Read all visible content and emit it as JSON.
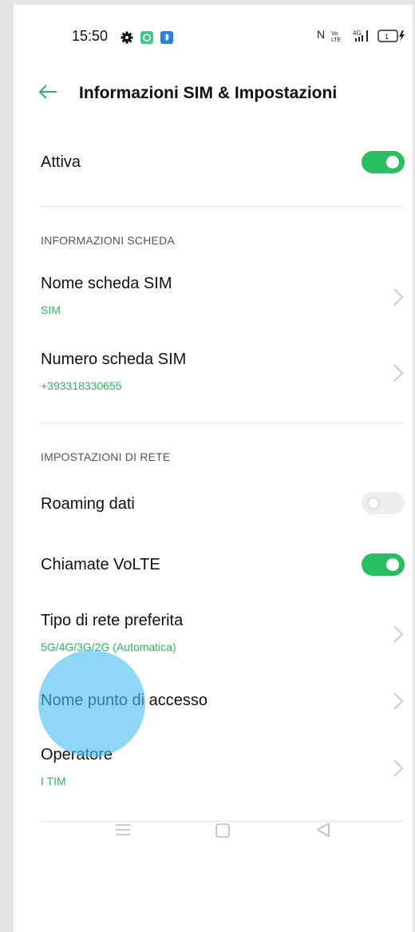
{
  "status_bar": {
    "time": "15:50",
    "right_text": "N",
    "icons": [
      "settings-gear-icon",
      "app-notification-icon",
      "bluetooth-app-icon",
      "nfc-icon",
      "volte-icon",
      "4g-signal-icon",
      "battery-charging-icon"
    ]
  },
  "header": {
    "title": "Informazioni SIM & Impostazioni"
  },
  "active_row": {
    "label": "Attiva",
    "state": "on"
  },
  "card_info": {
    "header": "INFORMAZIONI SCHEDA",
    "sim_name": {
      "label": "Nome scheda SIM",
      "value": "SIM"
    },
    "sim_number": {
      "label": "Numero scheda SIM",
      "value": "+393318330655"
    }
  },
  "network": {
    "header": "IMPOSTAZIONI DI RETE",
    "roaming": {
      "label": "Roaming dati",
      "state": "off"
    },
    "volte": {
      "label": "Chiamate VoLTE",
      "state": "on"
    },
    "network_type": {
      "label": "Tipo di rete preferita",
      "value": "5G/4G/3G/2G (Automatica)"
    },
    "apn": {
      "label": "Nome punto di accesso"
    },
    "operator": {
      "label": "Operatore",
      "value": "I TIM"
    }
  },
  "colors": {
    "accent": "#28bf63",
    "subtext": "#2db65e",
    "touch_indicator": "#4abef0"
  }
}
